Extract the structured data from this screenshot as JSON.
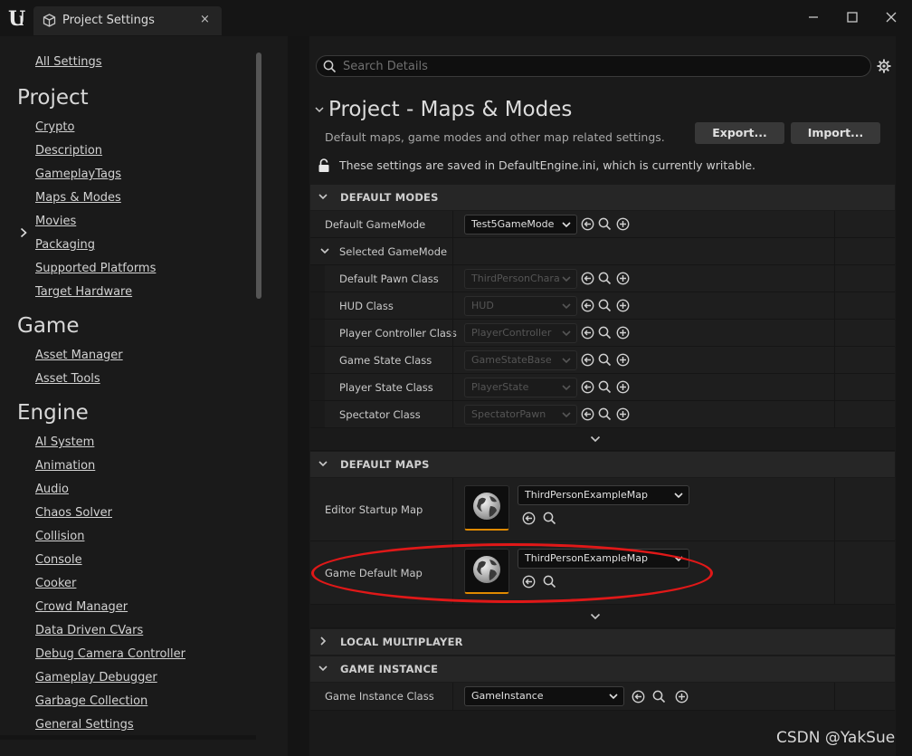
{
  "window": {
    "tab_title": "Project Settings",
    "close_glyph": "×",
    "minimize_glyph": "—",
    "maximize_glyph": "☐",
    "close_window_glyph": "✕"
  },
  "sidebar": {
    "all_settings": "All Settings",
    "project_heading": "Project",
    "project_items": [
      "Crypto",
      "Description",
      "GameplayTags",
      "Maps & Modes",
      "Movies",
      "Packaging",
      "Supported Platforms",
      "Target Hardware"
    ],
    "game_heading": "Game",
    "game_items": [
      "Asset Manager",
      "Asset Tools"
    ],
    "engine_heading": "Engine",
    "engine_items": [
      "AI System",
      "Animation",
      "Audio",
      "Chaos Solver",
      "Collision",
      "Console",
      "Cooker",
      "Crowd Manager",
      "Data Driven CVars",
      "Debug Camera Controller",
      "Gameplay Debugger",
      "Garbage Collection",
      "General Settings"
    ],
    "selected_item": "Maps & Modes"
  },
  "search": {
    "placeholder": "Search Details"
  },
  "header": {
    "title": "Project - Maps & Modes",
    "description": "Default maps, game modes and other map related settings.",
    "export_label": "Export...",
    "import_label": "Import...",
    "writable_note": "These settings are saved in DefaultEngine.ini, which is currently writable."
  },
  "default_modes": {
    "label": "DEFAULT MODES",
    "default_gamemode_label": "Default GameMode",
    "default_gamemode_value": "Test5GameMode",
    "selected_gamemode_label": "Selected GameMode",
    "rows": [
      {
        "label": "Default Pawn Class",
        "value": "ThirdPersonChara"
      },
      {
        "label": "HUD Class",
        "value": "HUD"
      },
      {
        "label": "Player Controller Class",
        "value": "PlayerController"
      },
      {
        "label": "Game State Class",
        "value": "GameStateBase"
      },
      {
        "label": "Player State Class",
        "value": "PlayerState"
      },
      {
        "label": "Spectator Class",
        "value": "SpectatorPawn"
      }
    ]
  },
  "default_maps": {
    "label": "DEFAULT MAPS",
    "editor_startup_label": "Editor Startup Map",
    "editor_startup_value": "ThirdPersonExampleMap",
    "game_default_label": "Game Default Map",
    "game_default_value": "ThirdPersonExampleMap"
  },
  "local_multiplayer": {
    "label": "LOCAL MULTIPLAYER"
  },
  "game_instance": {
    "label": "GAME INSTANCE",
    "class_label": "Game Instance Class",
    "class_value": "GameInstance"
  },
  "watermark": "CSDN @YakSue",
  "colors": {
    "highlight": "#e01818",
    "thumb_accent": "#e08a00"
  }
}
